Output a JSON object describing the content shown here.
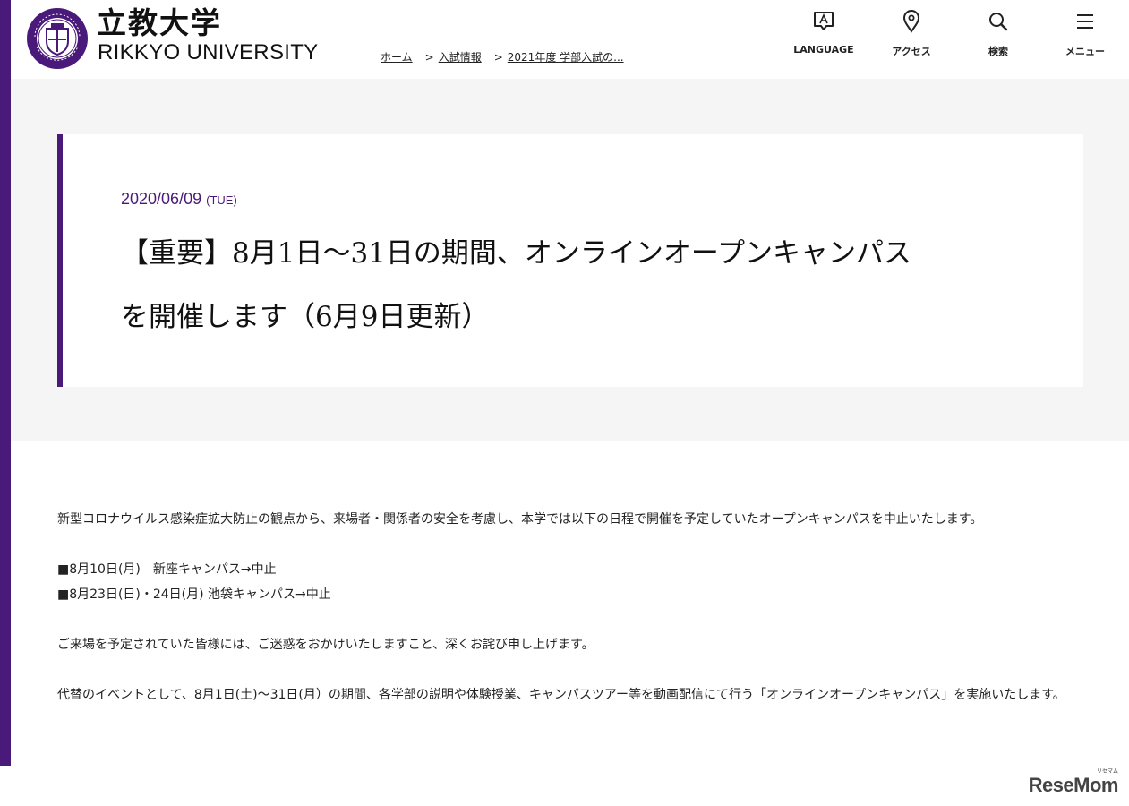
{
  "brand": {
    "name_jp": "立教大学",
    "name_en": "RIKKYO UNIVERSITY",
    "seal_text_top": "RIKKYO UNIVERSITY",
    "seal_text_bottom": "MDCCCLXXIV",
    "color": "#4a1a7a"
  },
  "breadcrumb": {
    "home": "ホーム",
    "sep": ">",
    "level1": "入試情報",
    "level2": "2021年度 学部入試の..."
  },
  "nav": {
    "language": {
      "label": "LANGUAGE",
      "icon": "language-icon"
    },
    "access": {
      "label": "アクセス",
      "icon": "map-pin-icon"
    },
    "search": {
      "label": "検索",
      "icon": "search-icon"
    },
    "menu": {
      "label": "メニュー",
      "icon": "hamburger-menu-icon"
    }
  },
  "post": {
    "date": "2020/06/09",
    "weekday": "(TUE)",
    "title_line1": "【重要】8月1日～31日の期間、オンラインオープンキャンパス",
    "title_line2": "を開催します（6月9日更新）"
  },
  "body": {
    "intro": "新型コロナウイルス感染症拡大防止の観点から、来場者・関係者の安全を考慮し、本学では以下の日程で開催を予定していたオープンキャンパスを中止いたします。",
    "schedule_1": "■8月10日(月)　新座キャンパス→中止",
    "schedule_2": "■8月23日(日)・24日(月) 池袋キャンパス→中止",
    "apology": "ご来場を予定されていた皆様には、ご迷惑をおかけいたしますこと、深くお詫び申し上げます。",
    "alternative": "代替のイベントとして、8月1日(土)～31日(月）の期間、各学部の説明や体験授業、キャンパスツアー等を動画配信にて行う「オンラインオープンキャンパス」を実施いたします。"
  },
  "watermark": {
    "text": "ReseMom",
    "small": "リセマム"
  }
}
